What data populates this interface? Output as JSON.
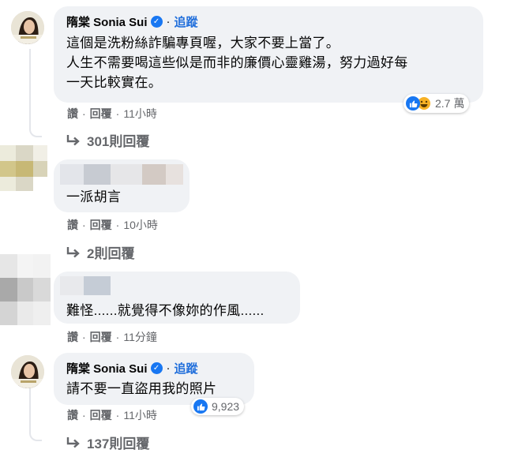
{
  "comments": [
    {
      "author": "隋棠 Sonia Sui",
      "follow_label": "追蹤",
      "text": "這個是洗粉絲詐騙專頁喔，大家不要上當了。\n人生不需要喝這些似是而非的廉價心靈雞湯，努力過好每\n一天比較實在。",
      "like_label": "讚",
      "reply_label": "回覆",
      "time": "11小時",
      "reactions_count": "2.7 萬",
      "replies_label": "301則回覆"
    },
    {
      "author": "",
      "text": "一派胡言",
      "like_label": "讚",
      "reply_label": "回覆",
      "time": "10小時",
      "replies_label": "2則回覆"
    },
    {
      "author": "",
      "text": "難怪......就覺得不像妳的作風......",
      "like_label": "讚",
      "reply_label": "回覆",
      "time": "11分鐘"
    },
    {
      "author": "隋棠 Sonia Sui",
      "follow_label": "追蹤",
      "text": "請不要一直盜用我的照片",
      "like_label": "讚",
      "reply_label": "回覆",
      "time": "11小時",
      "reactions_count": "9,923",
      "replies_label": "137則回覆"
    }
  ],
  "colors": {
    "bubble": "#f0f2f5",
    "link_blue": "#216fdb",
    "secondary_text": "#65676b",
    "like_blue": "#1877f2",
    "haha_yellow": "#f7b125"
  },
  "icons": [
    "verified-badge-icon",
    "like-reaction-icon",
    "haha-reaction-icon",
    "reply-arrow-icon"
  ]
}
